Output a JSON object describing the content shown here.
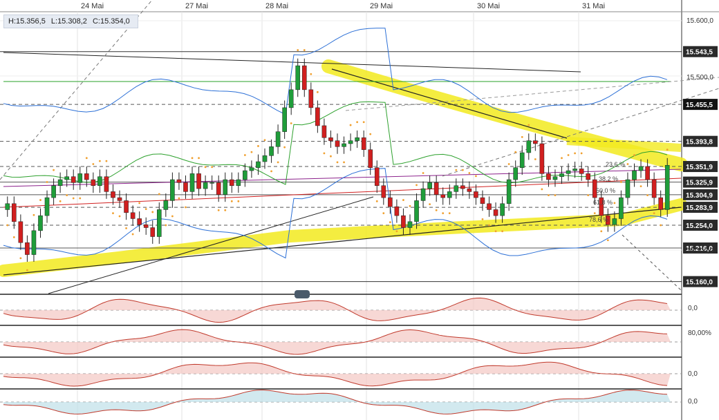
{
  "ohlc": {
    "high": "H:15.356,5",
    "low": "L:15.308,2",
    "close": "C:15.354,0"
  },
  "date_labels": [
    "24 Mai",
    "27 Mai",
    "28 Mai",
    "29 Mai",
    "30 Mai",
    "31 Mai"
  ],
  "price_axis_labels": [
    "15.600,0",
    "15.500,0",
    "15.200,0"
  ],
  "price_badges": [
    "15.543,5",
    "15.455,5",
    "15.393,8",
    "15.351,9",
    "15.325,9",
    "15.304,9",
    "15.283,9",
    "15.254,0",
    "15.216,0",
    "15.160,0"
  ],
  "fib_labels": [
    "23,6 %",
    "38,2 %",
    "50,0 %",
    "61,8 %",
    "78,6 %"
  ],
  "indicator_labels": [
    "0,0",
    "80,00%",
    "0,0",
    "0,0"
  ],
  "colors": {
    "bull": "#1f9d3a",
    "bear": "#d11f1f",
    "bollinger": "#2b6fd6",
    "highlight": "#f2ea1f",
    "psar": "#f0a030"
  },
  "chart_data": {
    "type": "candlestick",
    "x": [
      "24 Mai",
      "27 Mai",
      "28 Mai",
      "29 Mai",
      "30 Mai",
      "31 Mai"
    ],
    "ylim": [
      15140,
      15610
    ],
    "close_series": [
      15290,
      15260,
      15225,
      15205,
      15245,
      15270,
      15300,
      15320,
      15330,
      15335,
      15325,
      15340,
      15330,
      15320,
      15335,
      15310,
      15300,
      15295,
      15275,
      15265,
      15255,
      15250,
      15235,
      15280,
      15295,
      15330,
      15325,
      15310,
      15340,
      15315,
      15325,
      15325,
      15305,
      15330,
      15320,
      15330,
      15345,
      15350,
      15360,
      15370,
      15385,
      15410,
      15450,
      15480,
      15520,
      15480,
      15450,
      15420,
      15400,
      15395,
      15385,
      15390,
      15395,
      15400,
      15380,
      15350,
      15320,
      15300,
      15285,
      15270,
      15250,
      15260,
      15295,
      15315,
      15325,
      15305,
      15300,
      15310,
      15320,
      15315,
      15310,
      15300,
      15290,
      15280,
      15270,
      15290,
      15330,
      15350,
      15375,
      15395,
      15390,
      15340,
      15330,
      15335,
      15340,
      15345,
      15348,
      15340,
      15330,
      15300,
      15270,
      15255,
      15265,
      15300,
      15330,
      15345,
      15352,
      15330,
      15300,
      15280,
      15354
    ],
    "price_levels": [
      15543.5,
      15455.5,
      15393.8,
      15351.9,
      15325.9,
      15304.9,
      15283.9,
      15254.0,
      15216.0,
      15160.0
    ]
  }
}
